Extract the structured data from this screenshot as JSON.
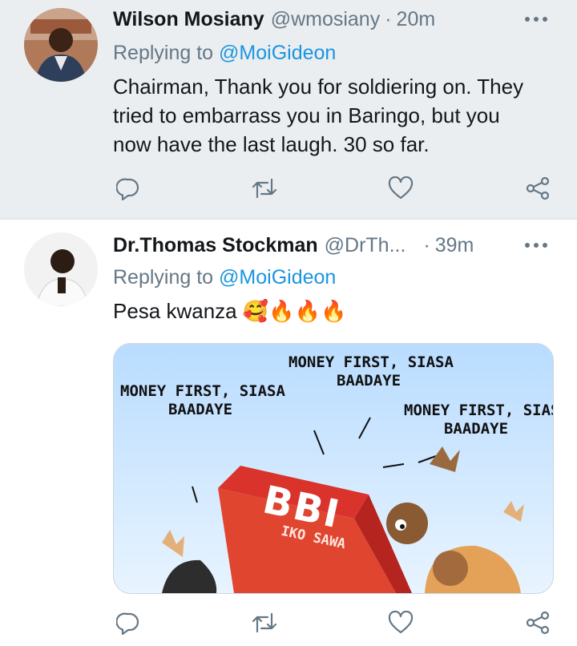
{
  "tweets": [
    {
      "name": "Wilson Mosiany",
      "handle": "@wmosiany",
      "dot": "·",
      "time": "20m",
      "replying_prefix": "Replying to",
      "replying_to": "@MoiGideon",
      "text_lines": [
        "Chairman, Thank you for soldiering on. They",
        "tried to embarrass you in Baringo, but you",
        "now have the last laugh. 30 so far."
      ]
    },
    {
      "name": "Dr.Thomas Stockman",
      "handle": "@DrTh...",
      "dot": "·",
      "time": "39m",
      "replying_prefix": "Replying to",
      "replying_to": "@MoiGideon",
      "text": "Pesa kwanza",
      "emojis": "🥰🔥🔥🔥",
      "media": {
        "captions": [
          "MONEY FIRST, SIASA\nBAADAYE",
          "MONEY FIRST, SIASA\nBAADAYE",
          "MONEY FIRST, SIASA\nBAADAYE"
        ],
        "book_title": "BBI",
        "book_subtitle": "IKO SAWA"
      }
    }
  ],
  "colors": {
    "accent": "#1b95e0",
    "secondary_text": "#657786",
    "primary_text": "#14171a",
    "selected_bg": "#ebeef0"
  }
}
